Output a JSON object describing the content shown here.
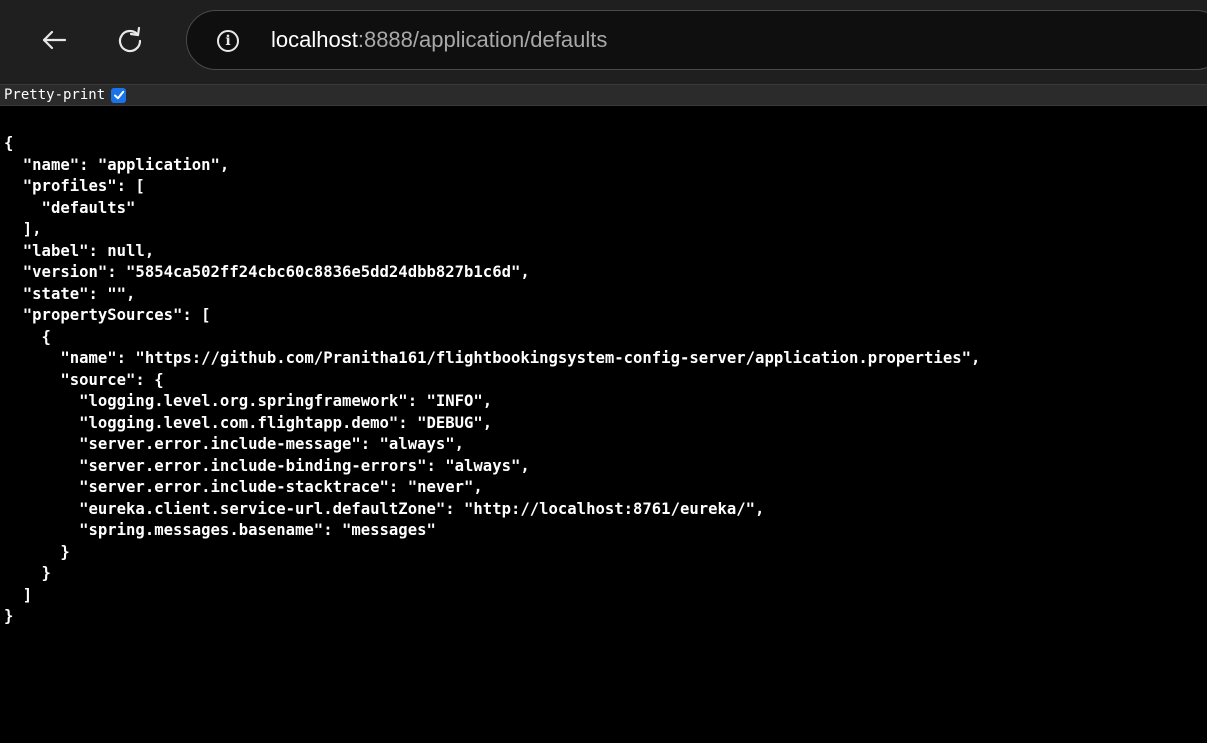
{
  "browser": {
    "url_host": "localhost",
    "url_rest": ":8888/application/defaults",
    "back_icon": "arrow-left-icon",
    "reload_icon": "reload-icon",
    "info_icon": "info-icon",
    "info_glyph": "i"
  },
  "pretty_print": {
    "label": "Pretty-print",
    "checked": true
  },
  "json_lines": [
    "{",
    "  \"name\": \"application\",",
    "  \"profiles\": [",
    "    \"defaults\"",
    "  ],",
    "  \"label\": null,",
    "  \"version\": \"5854ca502ff24cbc60c8836e5dd24dbb827b1c6d\",",
    "  \"state\": \"\",",
    "  \"propertySources\": [",
    "    {",
    "      \"name\": \"https://github.com/Pranitha161/flightbookingsystem-config-server/application.properties\",",
    "      \"source\": {",
    "        \"logging.level.org.springframework\": \"INFO\",",
    "        \"logging.level.com.flightapp.demo\": \"DEBUG\",",
    "        \"server.error.include-message\": \"always\",",
    "        \"server.error.include-binding-errors\": \"always\",",
    "        \"server.error.include-stacktrace\": \"never\",",
    "        \"eureka.client.service-url.defaultZone\": \"http://localhost:8761/eureka/\",",
    "        \"spring.messages.basename\": \"messages\"",
    "      }",
    "    }",
    "  ]",
    "}"
  ]
}
